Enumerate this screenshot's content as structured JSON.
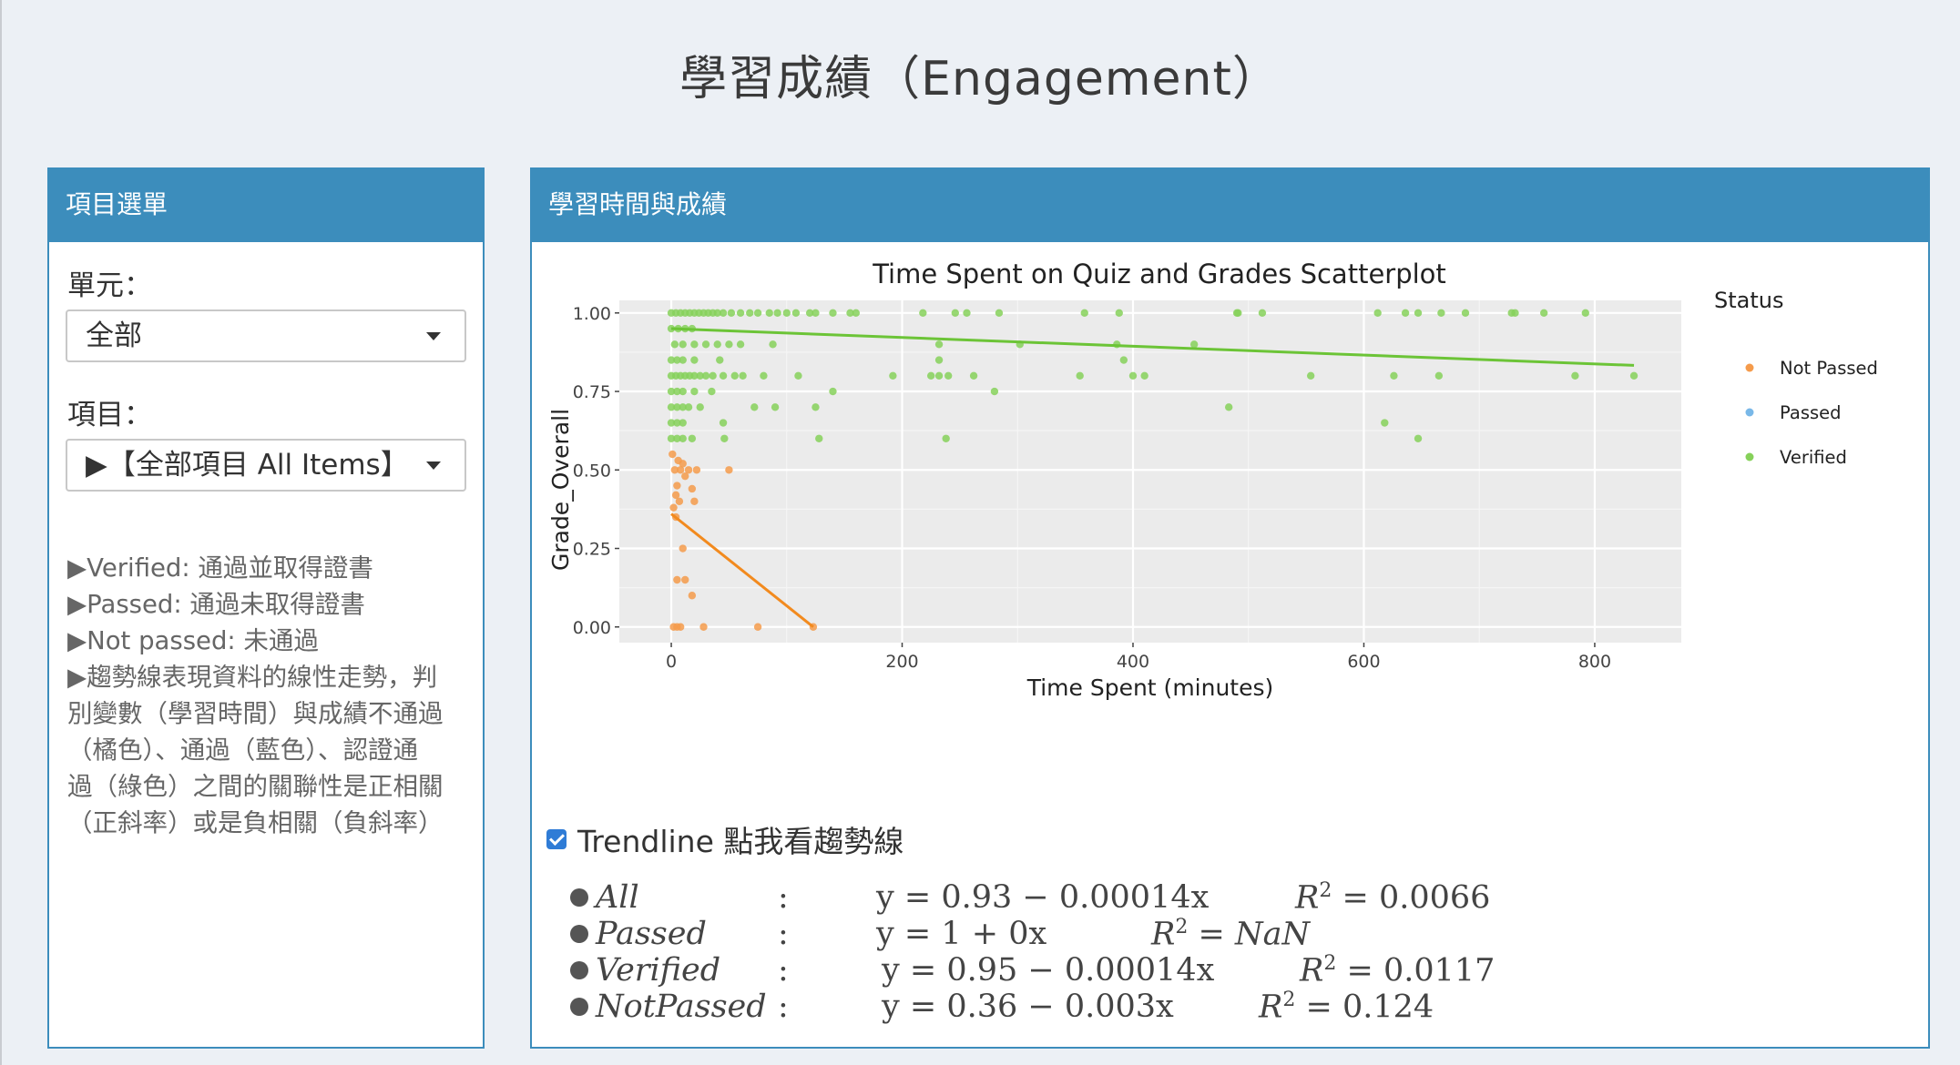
{
  "page_title": "學習成績（Engagement）",
  "left_panel": {
    "header": "項目選單",
    "unit_label": "單元：",
    "unit_value": "全部",
    "item_label": "項目：",
    "item_value": "▶【全部項目 All Items】",
    "description": [
      "▶Verified: 通過並取得證書",
      "▶Passed: 通過未取得證書",
      "▶Not passed: 未通過",
      "▶趨勢線表現資料的線性走勢，判",
      "別變數（學習時間）與成績不通過",
      "（橘色）、通過（藍色）、認證通",
      "過（綠色）之間的關聯性是正相關",
      "（正斜率）或是負相關（負斜率）"
    ]
  },
  "right_panel": {
    "header": "學習時間與成績",
    "trendline_label": "Trendline 點我看趨勢線",
    "trendline_checked": true,
    "equations": [
      {
        "name": "All",
        "eq": "y = 0.93 − 0.00014x",
        "r2_label": "R",
        "r2_value": "= 0.0066"
      },
      {
        "name": "Passed",
        "eq": "y = 1 + 0x",
        "r2_label": "R",
        "r2_value": "= NaN"
      },
      {
        "name": "Verified",
        "eq": "y = 0.95 − 0.00014x",
        "r2_label": "R",
        "r2_value": "= 0.0117"
      },
      {
        "name": "NotPassed",
        "eq": "y = 0.36 − 0.003x",
        "r2_label": "R",
        "r2_value": "= 0.124"
      }
    ]
  },
  "chart_data": {
    "type": "scatter",
    "title": "Time Spent on Quiz and Grades Scatterplot",
    "xlabel": "Time Spent (minutes)",
    "ylabel": "Grade_Overall",
    "xlim": [
      -45,
      875
    ],
    "ylim": [
      -0.05,
      1.04
    ],
    "xticks": [
      0,
      200,
      400,
      600,
      800
    ],
    "yticks": [
      0,
      0.25,
      0.5,
      0.75,
      1
    ],
    "ytick_labels": [
      "0.00",
      "0.25",
      "0.50",
      "0.75",
      "1.00"
    ],
    "grid": true,
    "legend_title": "Status",
    "legend_position": "right",
    "series": [
      {
        "name": "Not Passed",
        "color": "#f59b4b",
        "points": [
          [
            1,
            0.55
          ],
          [
            3,
            0.5
          ],
          [
            5,
            0.45
          ],
          [
            7,
            0.4
          ],
          [
            2,
            0.38
          ],
          [
            4,
            0.35
          ],
          [
            8,
            0.5
          ],
          [
            12,
            0.48
          ],
          [
            15,
            0.5
          ],
          [
            18,
            0.44
          ],
          [
            20,
            0.4
          ],
          [
            22,
            0.5
          ],
          [
            50,
            0.5
          ],
          [
            10,
            0.25
          ],
          [
            5,
            0.15
          ],
          [
            12,
            0.15
          ],
          [
            18,
            0.1
          ],
          [
            2,
            0
          ],
          [
            5,
            0
          ],
          [
            8,
            0
          ],
          [
            28,
            0
          ],
          [
            75,
            0
          ],
          [
            123,
            0
          ],
          [
            6,
            0.53
          ],
          [
            10,
            0.52
          ],
          [
            4,
            0.42
          ]
        ],
        "trendline": {
          "x": [
            0,
            123
          ],
          "y": [
            0.36,
            0
          ]
        }
      },
      {
        "name": "Passed",
        "color": "#79b8e8",
        "points": [],
        "trendline": null
      },
      {
        "name": "Verified",
        "color": "#86d15a",
        "points": [
          [
            0,
            1
          ],
          [
            4,
            1
          ],
          [
            8,
            1
          ],
          [
            12,
            1
          ],
          [
            16,
            1
          ],
          [
            20,
            1
          ],
          [
            24,
            1
          ],
          [
            28,
            1
          ],
          [
            32,
            1
          ],
          [
            36,
            1
          ],
          [
            40,
            1
          ],
          [
            45,
            1
          ],
          [
            52,
            1
          ],
          [
            60,
            1
          ],
          [
            68,
            1
          ],
          [
            75,
            1
          ],
          [
            85,
            1
          ],
          [
            92,
            1
          ],
          [
            100,
            1
          ],
          [
            108,
            1
          ],
          [
            120,
            1
          ],
          [
            125,
            1
          ],
          [
            140,
            1
          ],
          [
            155,
            1
          ],
          [
            160,
            1
          ],
          [
            218,
            1
          ],
          [
            246,
            1
          ],
          [
            256,
            1
          ],
          [
            284,
            1
          ],
          [
            358,
            1
          ],
          [
            388,
            1
          ],
          [
            490,
            1
          ],
          [
            491,
            1
          ],
          [
            512,
            1
          ],
          [
            612,
            1
          ],
          [
            636,
            1
          ],
          [
            647,
            1
          ],
          [
            667,
            1
          ],
          [
            688,
            1
          ],
          [
            728,
            1
          ],
          [
            731,
            1
          ],
          [
            756,
            1
          ],
          [
            792,
            1
          ],
          [
            0,
            0.95
          ],
          [
            6,
            0.95
          ],
          [
            12,
            0.95
          ],
          [
            18,
            0.95
          ],
          [
            3,
            0.9
          ],
          [
            10,
            0.9
          ],
          [
            20,
            0.9
          ],
          [
            30,
            0.9
          ],
          [
            40,
            0.9
          ],
          [
            50,
            0.9
          ],
          [
            60,
            0.9
          ],
          [
            88,
            0.9
          ],
          [
            232,
            0.9
          ],
          [
            302,
            0.9
          ],
          [
            386,
            0.9
          ],
          [
            453,
            0.9
          ],
          [
            0,
            0.85
          ],
          [
            5,
            0.85
          ],
          [
            10,
            0.85
          ],
          [
            20,
            0.85
          ],
          [
            42,
            0.85
          ],
          [
            232,
            0.85
          ],
          [
            392,
            0.85
          ],
          [
            0,
            0.8
          ],
          [
            4,
            0.8
          ],
          [
            8,
            0.8
          ],
          [
            12,
            0.8
          ],
          [
            16,
            0.8
          ],
          [
            20,
            0.8
          ],
          [
            25,
            0.8
          ],
          [
            30,
            0.8
          ],
          [
            36,
            0.8
          ],
          [
            45,
            0.8
          ],
          [
            55,
            0.8
          ],
          [
            62,
            0.8
          ],
          [
            80,
            0.8
          ],
          [
            110,
            0.8
          ],
          [
            192,
            0.8
          ],
          [
            225,
            0.8
          ],
          [
            232,
            0.8
          ],
          [
            240,
            0.8
          ],
          [
            262,
            0.8
          ],
          [
            354,
            0.8
          ],
          [
            400,
            0.8
          ],
          [
            410,
            0.8
          ],
          [
            554,
            0.8
          ],
          [
            626,
            0.8
          ],
          [
            665,
            0.8
          ],
          [
            783,
            0.8
          ],
          [
            834,
            0.8
          ],
          [
            0,
            0.75
          ],
          [
            5,
            0.75
          ],
          [
            10,
            0.75
          ],
          [
            20,
            0.75
          ],
          [
            35,
            0.75
          ],
          [
            140,
            0.75
          ],
          [
            280,
            0.75
          ],
          [
            0,
            0.7
          ],
          [
            5,
            0.7
          ],
          [
            10,
            0.7
          ],
          [
            15,
            0.7
          ],
          [
            25,
            0.7
          ],
          [
            72,
            0.7
          ],
          [
            90,
            0.7
          ],
          [
            125,
            0.7
          ],
          [
            483,
            0.7
          ],
          [
            0,
            0.65
          ],
          [
            5,
            0.65
          ],
          [
            10,
            0.65
          ],
          [
            45,
            0.65
          ],
          [
            618,
            0.65
          ],
          [
            0,
            0.6
          ],
          [
            5,
            0.6
          ],
          [
            10,
            0.6
          ],
          [
            18,
            0.6
          ],
          [
            46,
            0.6
          ],
          [
            128,
            0.6
          ],
          [
            238,
            0.6
          ],
          [
            647,
            0.6
          ]
        ],
        "trendline": {
          "x": [
            0,
            834
          ],
          "y": [
            0.95,
            0.833
          ]
        }
      }
    ]
  }
}
